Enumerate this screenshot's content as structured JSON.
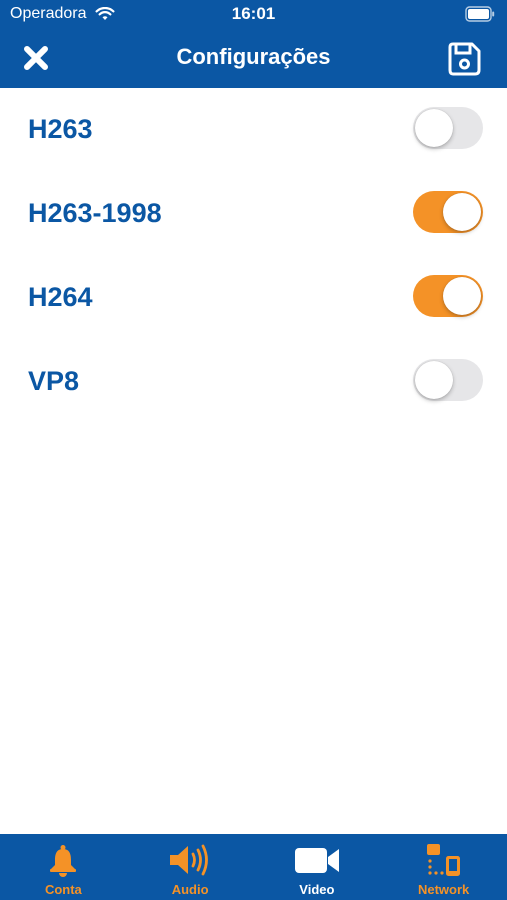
{
  "status_bar": {
    "carrier": "Operadora",
    "time": "16:01"
  },
  "header": {
    "title": "Configurações",
    "close_icon": "close-icon",
    "save_icon": "floppy-disk-icon"
  },
  "codecs": [
    {
      "label": "H263",
      "enabled": false
    },
    {
      "label": "H263-1998",
      "enabled": true
    },
    {
      "label": "H264",
      "enabled": true
    },
    {
      "label": "VP8",
      "enabled": false
    }
  ],
  "tabs": [
    {
      "label": "Conta",
      "icon": "bell-icon",
      "active": false
    },
    {
      "label": "Audio",
      "icon": "speaker-icon",
      "active": false
    },
    {
      "label": "Video",
      "icon": "video-camera-icon",
      "active": true
    },
    {
      "label": "Network",
      "icon": "network-icon",
      "active": false
    }
  ],
  "colors": {
    "primary": "#0b57a4",
    "accent": "#f49227",
    "toggle_off": "#e6e6e8",
    "background": "#ffffff"
  }
}
